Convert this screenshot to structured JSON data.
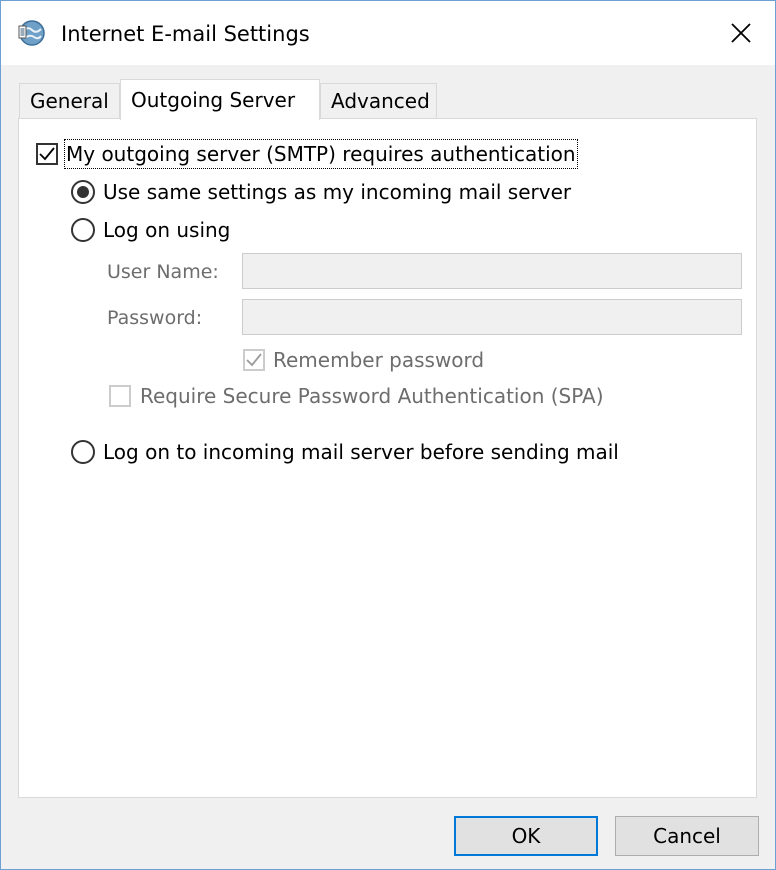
{
  "window": {
    "title": "Internet E-mail Settings",
    "icon": "outlook-globe-icon"
  },
  "tabs": [
    {
      "label": "General",
      "active": false
    },
    {
      "label": "Outgoing Server",
      "active": true
    },
    {
      "label": "Advanced",
      "active": false
    }
  ],
  "smtp_auth": {
    "label": "My outgoing server (SMTP) requires authentication",
    "checked": true
  },
  "options": {
    "use_same": {
      "label": "Use same settings as my incoming mail server",
      "selected": true
    },
    "log_on_using": {
      "label": "Log on using",
      "selected": false
    },
    "log_on_incoming": {
      "label": "Log on to incoming mail server before sending mail",
      "selected": false
    }
  },
  "credentials": {
    "username_label": "User Name:",
    "username_value": "",
    "password_label": "Password:",
    "password_value": "",
    "remember_label": "Remember password",
    "remember_checked": true,
    "spa_label": "Require Secure Password Authentication (SPA)",
    "spa_checked": false
  },
  "buttons": {
    "ok": "OK",
    "cancel": "Cancel"
  },
  "colors": {
    "accent": "#0078d7",
    "disabled_text": "#6d6d6d",
    "panel_bg": "#ffffff",
    "dialog_bg": "#f0f0f0"
  }
}
